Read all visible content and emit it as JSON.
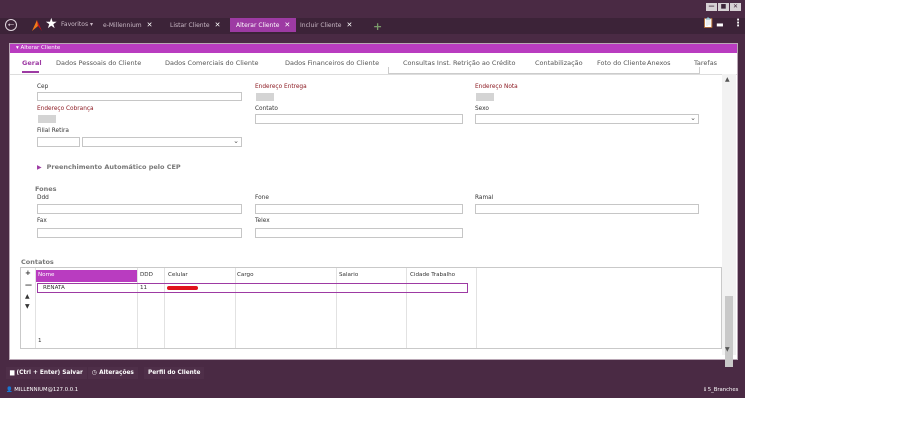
{
  "topbar": {
    "back_icon": "back-circle-icon",
    "favorites_label": "Favoritos",
    "favorites_caret": "▾",
    "tabs": [
      {
        "label": "e-Millennium"
      },
      {
        "label": "Listar Cliente"
      },
      {
        "label": "Alterar Cliente"
      },
      {
        "label": "Incluir Cliente"
      }
    ],
    "add_tab": "+",
    "window_buttons": [
      "—",
      "■",
      "✕"
    ]
  },
  "panel": {
    "header": "▾ Alterar Cliente",
    "subtabs": [
      "Geral",
      "Dados Pessoais do Cliente",
      "Dados Comerciais do Cliente",
      "Dados Financeiros do Cliente",
      "Consultas Inst. Retrição ao Crédito",
      "Contabilização",
      "Foto do Cliente",
      "Anexos",
      "Tarefas"
    ]
  },
  "form": {
    "cep": "Cep",
    "endereco_entrega": "Endereço Entrega",
    "endereco_nota": "Endereço Nota",
    "endereco_cobranca": "Endereço Cobrança",
    "contato": "Contato",
    "sexo": "Sexo",
    "filial_retira": "Filial Retira",
    "preenchimento": "Preenchimento Automático pelo CEP",
    "fones": "Fones",
    "ddd": "Ddd",
    "fone": "Fone",
    "ramal": "Ramal",
    "fax": "Fax",
    "telex": "Telex"
  },
  "contatos": {
    "title": "Contatos",
    "columns": [
      "Nome",
      "DDD",
      "Celular",
      "Cargo",
      "Salario",
      "Cidade Trabalho"
    ],
    "rows": [
      {
        "nome": "RENATA",
        "ddd": "11"
      }
    ],
    "count": "1",
    "controls": [
      "+",
      "—",
      "▲",
      "▼"
    ]
  },
  "footer": {
    "save": "(Ctrl + Enter) Salvar",
    "changes": "Alterações",
    "profile": "Perfil do Cliente",
    "user": "MILLENNIUM@127.0.0.1",
    "branches": "5_Branches"
  },
  "colors": {
    "accent": "#b93cc0",
    "frame": "#4a2a44",
    "label_red": "#8c1a22"
  }
}
